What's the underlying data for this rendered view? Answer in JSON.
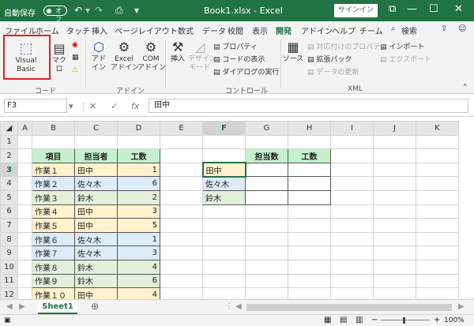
{
  "titlebar": {
    "autosave": "自動保存",
    "toggle": "オフ",
    "title": "Book1.xlsx  -  Excel",
    "signin": "サインイン"
  },
  "tabs": [
    "ファイル",
    "ホーム",
    "タッチ",
    "挿入",
    "ページレイアウト",
    "数式",
    "データ",
    "校閲",
    "表示",
    "開発",
    "アドイン",
    "ヘルプ",
    "チーム"
  ],
  "tell_me": "検索",
  "ribbon": {
    "visual_basic": "Visual Basic",
    "macro": "マクロ",
    "addin": "アド\nイン",
    "excel_addin": "Excel\nアドイン",
    "com_addin": "COM\nアドイン",
    "insert": "挿入",
    "design_mode": "デザイン\nモード",
    "properties": "プロパティ",
    "view_code": "コードの表示",
    "run_dialog": "ダイアログの実行",
    "source": "ソース",
    "map_props": "対応付けのプロパティ",
    "expansion_pack": "拡張パック",
    "refresh_data": "データの更新",
    "import": "インポート",
    "export": "エクスポート",
    "groups": {
      "code": "コード",
      "addins": "アドイン",
      "controls": "コントロール",
      "xml": "XML"
    }
  },
  "formula": {
    "namebox": "F3",
    "fx": "fx",
    "value": "田中"
  },
  "columns": [
    "A",
    "B",
    "C",
    "D",
    "E",
    "F",
    "G",
    "H",
    "I",
    "J",
    "K"
  ],
  "rows": [
    {
      "n": "1",
      "B": "",
      "C": "",
      "D": "",
      "F": "",
      "G": "",
      "H": ""
    },
    {
      "n": "2",
      "B": "項目",
      "C": "担当者",
      "D": "工数",
      "F": "",
      "G": "担当数",
      "H": "工数"
    },
    {
      "n": "3",
      "B": "作業１",
      "C": "田中",
      "D": "1",
      "F": "田中",
      "G": "",
      "H": ""
    },
    {
      "n": "4",
      "B": "作業２",
      "C": "佐々木",
      "D": "6",
      "F": "佐々木",
      "G": "",
      "H": ""
    },
    {
      "n": "5",
      "B": "作業３",
      "C": "鈴木",
      "D": "2",
      "F": "鈴木",
      "G": "",
      "H": ""
    },
    {
      "n": "6",
      "B": "作業４",
      "C": "田中",
      "D": "3",
      "F": "",
      "G": "",
      "H": ""
    },
    {
      "n": "7",
      "B": "作業５",
      "C": "田中",
      "D": "5",
      "F": "",
      "G": "",
      "H": ""
    },
    {
      "n": "8",
      "B": "作業６",
      "C": "佐々木",
      "D": "1",
      "F": "",
      "G": "",
      "H": ""
    },
    {
      "n": "9",
      "B": "作業７",
      "C": "佐々木",
      "D": "3",
      "F": "",
      "G": "",
      "H": ""
    },
    {
      "n": "10",
      "B": "作業８",
      "C": "鈴木",
      "D": "4",
      "F": "",
      "G": "",
      "H": ""
    },
    {
      "n": "11",
      "B": "作業９",
      "C": "鈴木",
      "D": "6",
      "F": "",
      "G": "",
      "H": ""
    },
    {
      "n": "12",
      "B": "作業１０",
      "C": "田中",
      "D": "4",
      "F": "",
      "G": "",
      "H": ""
    }
  ],
  "colors": {
    "green": "#217346",
    "header_fill": "#c6efce",
    "tanaka": "#fff2cc",
    "sasaki": "#ddebf7",
    "suzuki": "#e2efda"
  },
  "sheet": {
    "name": "Sheet1"
  },
  "zoom": "100%"
}
